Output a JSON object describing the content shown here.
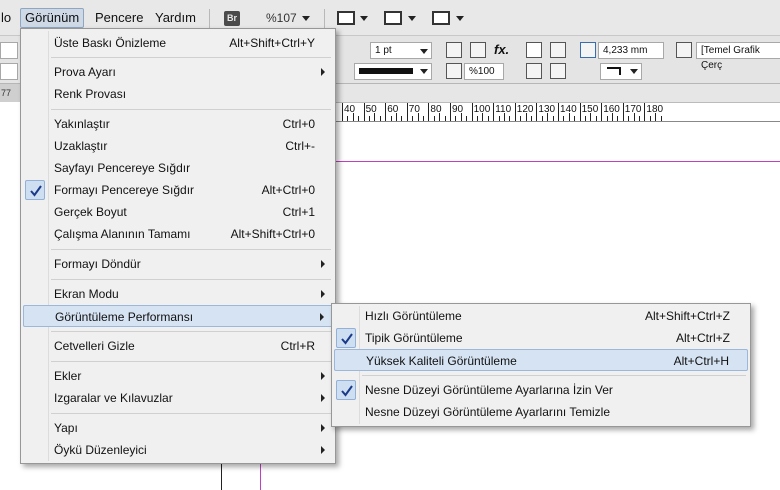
{
  "menubar": {
    "items": [
      {
        "label": "lo"
      },
      {
        "label": "Görünüm"
      },
      {
        "label": "Pencere"
      },
      {
        "label": "Yardım"
      }
    ],
    "bridge_badge": "Br",
    "zoom": "%107"
  },
  "control": {
    "stroke_weight": "1 pt",
    "opacity": "%100",
    "size_value": "4,233 mm",
    "style_name": "[Temel Grafik Çerç"
  },
  "ruler": {
    "corner": "77",
    "labels": [
      "40",
      "50",
      "60",
      "70",
      "80",
      "90",
      "100",
      "110",
      "120",
      "130",
      "140",
      "150",
      "160",
      "170",
      "180"
    ]
  },
  "view_menu": {
    "items": [
      {
        "label": "Üste Baskı Önizleme",
        "shortcut": "Alt+Shift+Ctrl+Y"
      },
      {
        "label": "Prova Ayarı",
        "submenu": true
      },
      {
        "label": "Renk Provası"
      },
      {
        "label": "Yakınlaştır",
        "shortcut": "Ctrl+0"
      },
      {
        "label": "Uzaklaştır",
        "shortcut": "Ctrl+-"
      },
      {
        "label": "Sayfayı Pencereye Sığdır"
      },
      {
        "label": "Formayı Pencereye Sığdır",
        "shortcut": "Alt+Ctrl+0",
        "checked": true
      },
      {
        "label": "Gerçek Boyut",
        "shortcut": "Ctrl+1"
      },
      {
        "label": "Çalışma Alanının Tamamı",
        "shortcut": "Alt+Shift+Ctrl+0"
      },
      {
        "label": "Formayı Döndür",
        "submenu": true
      },
      {
        "label": "Ekran Modu",
        "submenu": true
      },
      {
        "label": "Görüntüleme Performansı",
        "submenu": true,
        "highlighted": true
      },
      {
        "label": "Cetvelleri Gizle",
        "shortcut": "Ctrl+R"
      },
      {
        "label": "Ekler",
        "submenu": true
      },
      {
        "label": "Izgaralar ve Kılavuzlar",
        "submenu": true
      },
      {
        "label": "Yapı",
        "submenu": true
      },
      {
        "label": "Öykü Düzenleyici",
        "submenu": true
      }
    ]
  },
  "perf_menu": {
    "items": [
      {
        "label": "Hızlı Görüntüleme",
        "shortcut": "Alt+Shift+Ctrl+Z"
      },
      {
        "label": "Tipik Görüntüleme",
        "shortcut": "Alt+Ctrl+Z",
        "checked": true
      },
      {
        "label": "Yüksek Kaliteli Görüntüleme",
        "shortcut": "Alt+Ctrl+H",
        "highlighted": true
      },
      {
        "label": "Nesne Düzeyi Görüntüleme Ayarlarına İzin Ver",
        "checked": true
      },
      {
        "label": "Nesne Düzeyi Görüntüleme Ayarlarını Temizle"
      }
    ]
  },
  "colors": {
    "highlight": "#d6e3f3",
    "guide": "#c040c0",
    "check": "#1a3a8a"
  }
}
